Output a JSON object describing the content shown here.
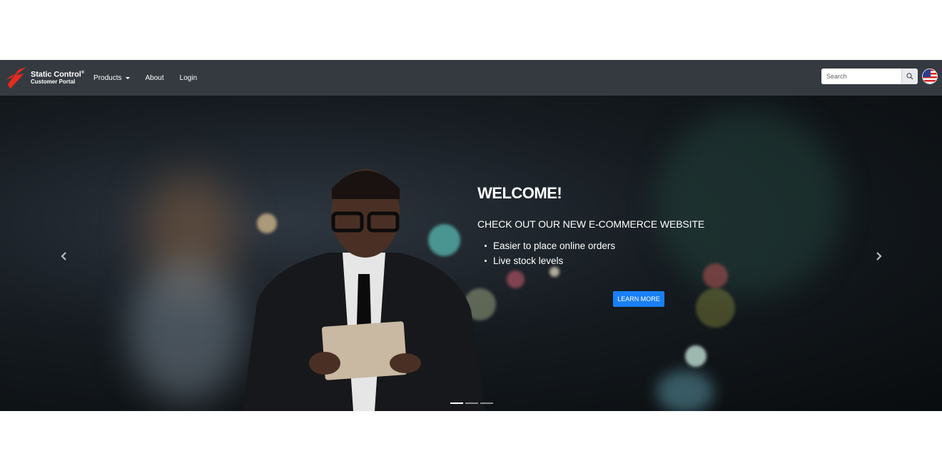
{
  "navbar": {
    "brand_name": "Static Control",
    "brand_reg": "®",
    "brand_sub": "Customer Portal",
    "links": [
      {
        "label": "Products",
        "has_dropdown": true
      },
      {
        "label": "About"
      },
      {
        "label": "Login"
      }
    ],
    "search_placeholder": "Search",
    "search_icon": "magnifier-icon",
    "locale_icon": "us-flag-icon"
  },
  "carousel": {
    "title": "WELCOME!",
    "subtitle": "CHECK OUT OUR NEW E-COMMERCE WEBSITE",
    "bullets": [
      "Easier to place online orders",
      "Live stock levels"
    ],
    "cta_label": "LEARN MORE",
    "prev_icon": "chevron-left-icon",
    "next_icon": "chevron-right-icon",
    "slide_count": 3,
    "active_slide": 1,
    "colors": {
      "cta": "#1a7ff5",
      "navbar": "#343a40",
      "logo": "#e62b1e"
    }
  }
}
